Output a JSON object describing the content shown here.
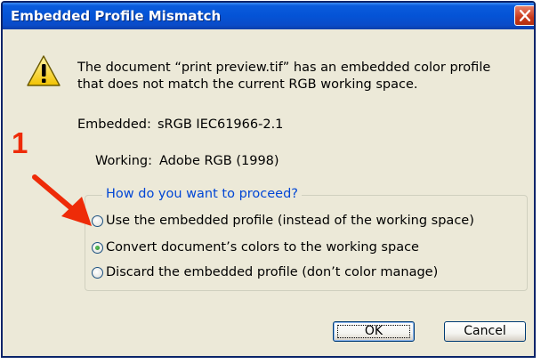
{
  "dialog": {
    "title": "Embedded Profile Mismatch",
    "message_line1": "The document “print preview.tif” has an embedded color profile",
    "message_line2": "that does not match the current RGB working space.",
    "embedded_label": "Embedded:",
    "embedded_value": "sRGB IEC61966-2.1",
    "working_label": "Working:",
    "working_value": "Adobe RGB (1998)",
    "group_title": "How do you want to proceed?",
    "options": [
      {
        "label": "Use the embedded profile (instead of the working space)",
        "selected": false
      },
      {
        "label": "Convert document’s colors to the working space",
        "selected": true
      },
      {
        "label": "Discard the embedded profile (don’t color manage)",
        "selected": false
      }
    ],
    "ok_label": "OK",
    "cancel_label": "Cancel"
  },
  "annotation": {
    "number": "1",
    "color": "#ee2b08"
  },
  "icons": {
    "warning": "warning-icon",
    "close": "close-icon"
  },
  "colors": {
    "titlebar": "#0453d6",
    "dialog_bg": "#ece9d8",
    "group_title": "#0046d5"
  }
}
